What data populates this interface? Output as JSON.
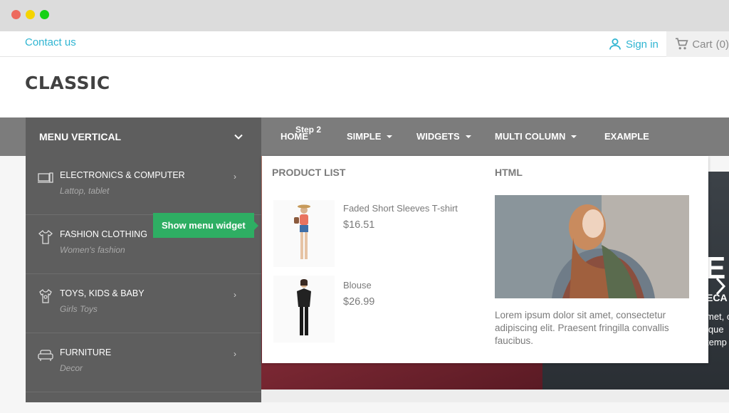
{
  "topbar": {
    "contact": "Contact us",
    "signin": "Sign in",
    "cart": "Cart",
    "cart_count": "(0)"
  },
  "header": {
    "logo": "CLASSIC"
  },
  "vertical_menu": {
    "title": "MENU VERTICAL",
    "items": [
      {
        "title": "ELECTRONICS & COMPUTER",
        "sub": "Lattop, tablet",
        "icon": "laptop-icon"
      },
      {
        "title": "FASHION CLOTHING",
        "sub": "Women's fashion",
        "icon": "shirt-icon"
      },
      {
        "title": "TOYS, KIDS & BABY",
        "sub": "Girls Toys",
        "icon": "baby-clothes-icon"
      },
      {
        "title": "FURNITURE",
        "sub": "Decor",
        "icon": "sofa-icon"
      }
    ]
  },
  "nav": {
    "step": "Step 2",
    "items": [
      {
        "label": "HOME"
      },
      {
        "label": "SIMPLE"
      },
      {
        "label": "WIDGETS"
      },
      {
        "label": "MULTI COLUMN"
      },
      {
        "label": "EXAMPLE"
      }
    ]
  },
  "tooltip": "Show menu widget",
  "mega": {
    "product_list_title": "PRODUCT LIST",
    "html_title": "HTML",
    "products": [
      {
        "name": "Faded Short Sleeves T-shirt",
        "price": "$16.51"
      },
      {
        "name": "Blouse",
        "price": "$26.99"
      }
    ],
    "html_text": "Lorem ipsum dolor sit amet, consectetur adipiscing elit. Praesent fringilla convallis faucibus."
  },
  "slider": {
    "letter": "E",
    "sub": "ECA",
    "text": "met, c\nique\ntemp"
  },
  "colors": {
    "accent": "#2fb5d2",
    "nav_bg": "#7c7c7c",
    "menu_bg": "#5e5e5e",
    "tooltip": "#2eae63"
  }
}
